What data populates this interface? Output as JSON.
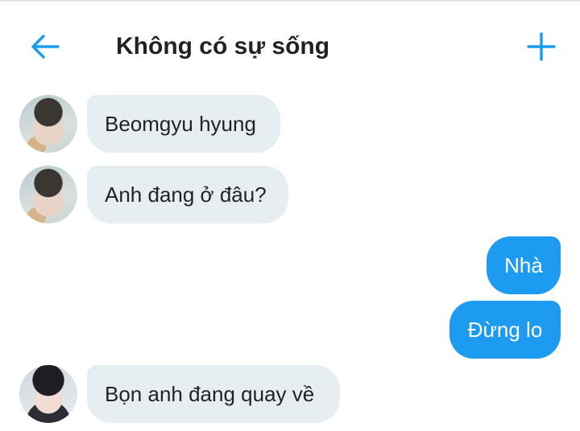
{
  "header": {
    "title": "Không có sự sống",
    "back_icon": "arrow-left-icon",
    "add_icon": "plus-icon",
    "accent_color": "#1d9bf0"
  },
  "messages": [
    {
      "direction": "incoming",
      "text": "Beomgyu hyung",
      "avatar": "avatar-1"
    },
    {
      "direction": "incoming",
      "text": "Anh đang ở đâu?",
      "avatar": "avatar-1"
    },
    {
      "direction": "outgoing",
      "text": "Nhà"
    },
    {
      "direction": "outgoing",
      "text": "Đừng lo"
    },
    {
      "direction": "incoming",
      "text": "Bọn anh đang quay về",
      "avatar": "avatar-2"
    }
  ],
  "colors": {
    "incoming_bubble": "#e7eef2",
    "outgoing_bubble": "#1d9bf0"
  }
}
